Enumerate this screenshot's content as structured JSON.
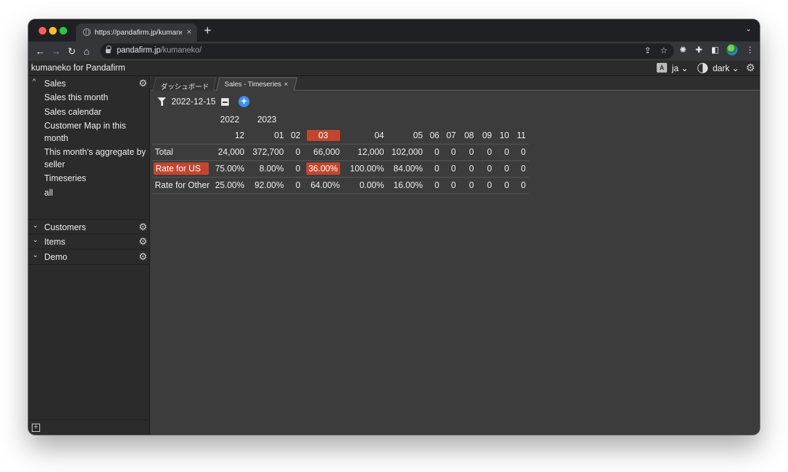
{
  "browser": {
    "tab_title": "https://pandafirm.jp/kumaneko/",
    "tab_close": "×",
    "new_tab": "+",
    "tabs_menu": "⌄",
    "url_host": "pandafirm.jp",
    "url_path": "/kumaneko/",
    "nav": {
      "back": "←",
      "forward": "→",
      "reload": "↻",
      "home": "⌂"
    },
    "icons": [
      "share-icon",
      "star-icon",
      "extension-icon",
      "puzzle-icon",
      "sidepanel-icon",
      "profile-avatar",
      "menu-icon"
    ]
  },
  "app": {
    "title": "kumaneko for Pandafirm",
    "language": "ja",
    "theme": "dark",
    "lang_icon_glyph": "A"
  },
  "sidebar": {
    "sections": [
      {
        "label": "Sales",
        "expanded": true,
        "chevron": "^",
        "items": [
          "Sales this month",
          "Sales calendar",
          "Customer Map in this month",
          "This month's aggregate by seller",
          "Timeseries",
          "all"
        ]
      },
      {
        "label": "Customers",
        "expanded": false,
        "chevron": "⌄"
      },
      {
        "label": "Items",
        "expanded": false,
        "chevron": "⌄"
      },
      {
        "label": "Demo",
        "expanded": false,
        "chevron": "⌄"
      }
    ]
  },
  "main": {
    "tabs": [
      {
        "label": "ダッシュボード",
        "active": false
      },
      {
        "label": "Sales - Timeseries",
        "active": true,
        "close": "×"
      }
    ],
    "filter_date": "2022-12-15",
    "add_label": "+"
  },
  "table": {
    "years": {
      "y2022": "2022",
      "y2023": "2023"
    },
    "months": [
      "12",
      "01",
      "02",
      "03",
      "04",
      "05",
      "06",
      "07",
      "08",
      "09",
      "10",
      "11"
    ],
    "highlight_month_index": 3,
    "rows": [
      {
        "label": "Total",
        "values": [
          "24,000",
          "372,700",
          "0",
          "66,000",
          "12,000",
          "102,000",
          "0",
          "0",
          "0",
          "0",
          "0",
          "0"
        ]
      },
      {
        "label": "Rate for US",
        "values": [
          "75.00%",
          "8.00%",
          "0",
          "36.00%",
          "100.00%",
          "84.00%",
          "0",
          "0",
          "0",
          "0",
          "0",
          "0"
        ]
      },
      {
        "label": "Rate for Other",
        "values": [
          "25.00%",
          "92.00%",
          "0",
          "64.00%",
          "0.00%",
          "16.00%",
          "0",
          "0",
          "0",
          "0",
          "0",
          "0"
        ]
      }
    ],
    "highlight_color": "#c2462e"
  },
  "colors": {
    "accent_blue": "#3d8ff0",
    "highlight": "#c2462e",
    "panel_bg": "#3c3c3c",
    "sidebar_bg": "#2b2b2b"
  }
}
